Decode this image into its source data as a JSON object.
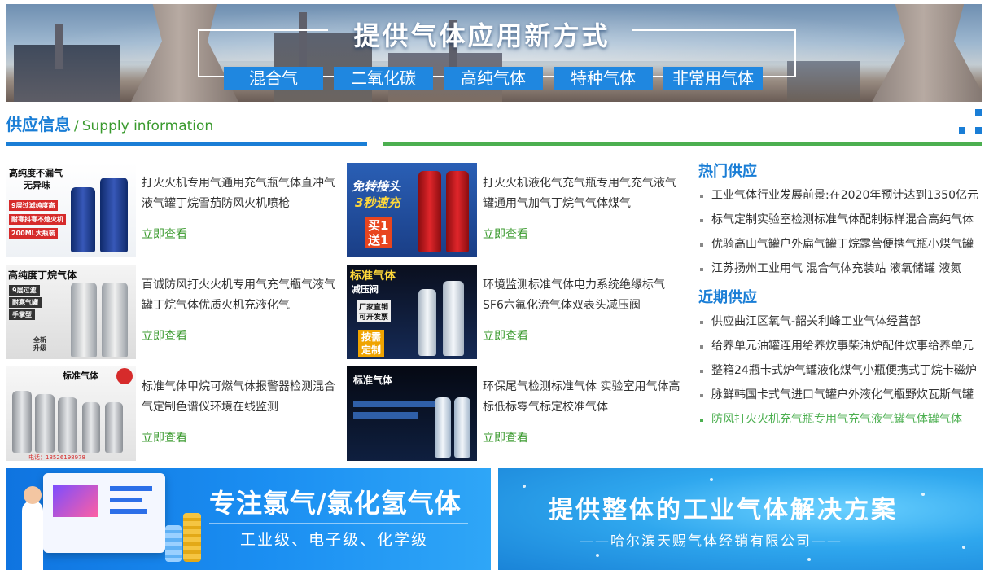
{
  "hero": {
    "title": "提供气体应用新方式",
    "buttons": [
      "混合气",
      "二氧化碳",
      "高纯气体",
      "特种气体",
      "非常用气体"
    ]
  },
  "section": {
    "title_cn": "供应信息",
    "separator": "/",
    "title_en": "Supply information"
  },
  "products": [
    {
      "desc": "打火火机专用气通用充气瓶气体直冲气液气罐丁烷雪茄防风火机喷枪",
      "more": "立即查看",
      "thumb_text": [
        "高纯度不漏气",
        "无异味",
        "9层过滤纯度高",
        "耐寒抖寒不熄火机",
        "200ML大瓶装"
      ]
    },
    {
      "desc": "打火火机液化气充气瓶专用气充气液气罐通用气加气丁烷气气体煤气",
      "more": "立即查看",
      "thumb_text": [
        "免转接头",
        "3秒速充",
        "买1",
        "送1"
      ]
    },
    {
      "desc": "百诚防风打火火机专用气充气瓶气液气罐丁烷气体优质火机充液化气",
      "more": "立即查看",
      "thumb_text": [
        "高纯度丁烷气体",
        "9层过滤",
        "耐寒气罐",
        "手掌型",
        "全新",
        "升级"
      ]
    },
    {
      "desc": "环境监测标准气体电力系统绝缘标气SF6六氟化流气体双表头减压阀",
      "more": "立即查看",
      "thumb_text": [
        "标准气体",
        "减压阀",
        "厂家直销",
        "可开发票",
        "按需",
        "定制"
      ]
    },
    {
      "desc": "标准气体甲烷可燃气体报警器检测混合气定制色谱仪环境在线监测",
      "more": "立即查看",
      "thumb_text": [
        "标准气体",
        "电话：18526198978"
      ]
    },
    {
      "desc": "环保尾气检测标准气体 实验室用气体高标低标零气标定校准气体",
      "more": "立即查看",
      "thumb_text": [
        "标准气体"
      ]
    }
  ],
  "hot_supply": {
    "title": "热门供应",
    "items": [
      "工业气体行业发展前景:在2020年预计达到1350亿元",
      "标气定制实验室检测标准气体配制标样混合高纯气体",
      "优骑高山气罐户外扁气罐丁烷露营便携气瓶小煤气罐",
      "江苏扬州工业用气 混合气体充装站 液氧储罐 液氮"
    ]
  },
  "recent_supply": {
    "title": "近期供应",
    "items": [
      "供应曲江区氧气-韶关利峰工业气体经营部",
      "给养单元油罐连用给养炊事柴油炉配件炊事给养单元",
      "整箱24瓶卡式炉气罐液化煤气小瓶便携式丁烷卡磁炉",
      "脉鲜韩国卡式气进口气罐户外液化气瓶野炊瓦斯气罐",
      "防风打火火机充气瓶专用气充气液气罐气体罐气体"
    ]
  },
  "banner_left": {
    "title": "专注氯气/氯化氢气体",
    "subtitle": "工业级、电子级、化学级"
  },
  "banner_right": {
    "title": "提供整体的工业气体解决方案",
    "subtitle": "——哈尔滨天赐气体经销有限公司——"
  },
  "colors": {
    "primary_blue": "#1a7ed6",
    "accent_green": "#4caf50",
    "button_blue": "#1f87e0"
  }
}
